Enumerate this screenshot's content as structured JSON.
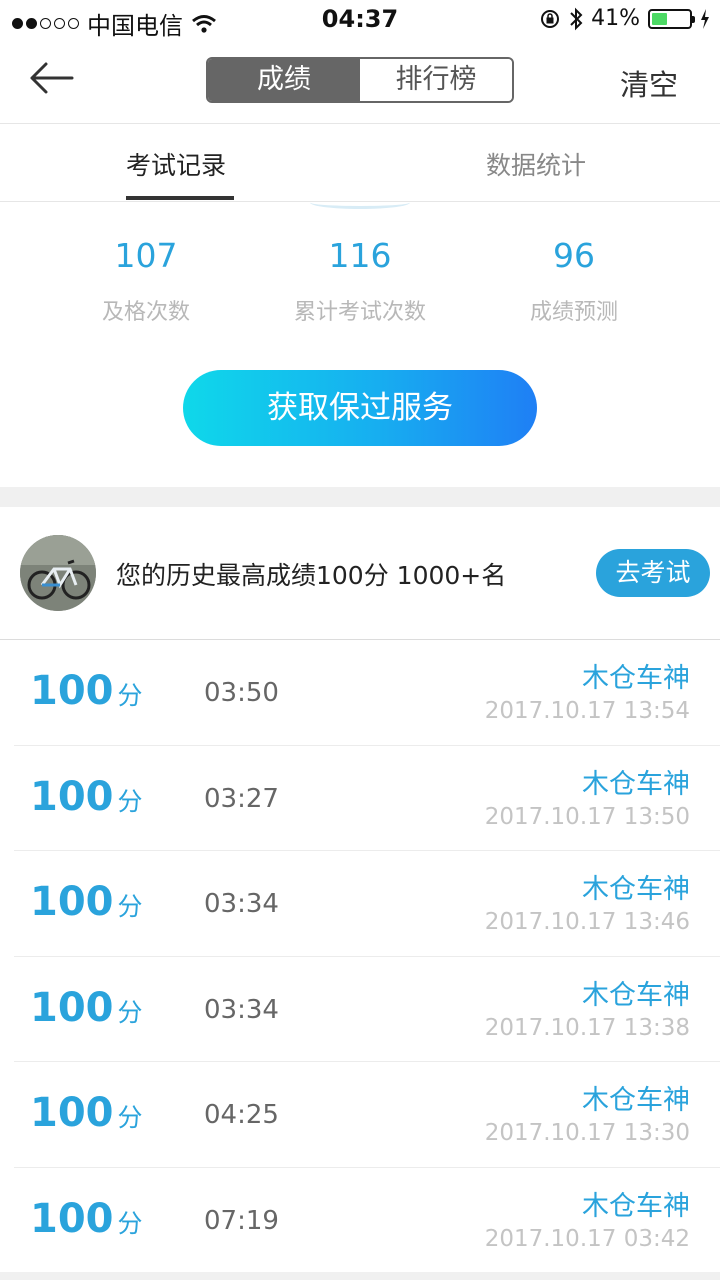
{
  "status_bar": {
    "carrier": "中国电信",
    "time": "04:37",
    "battery": "41%",
    "battery_level": 0.41
  },
  "nav": {
    "segments": [
      "成绩",
      "排行榜"
    ],
    "active_segment": 0,
    "clear_label": "清空"
  },
  "tabs": [
    {
      "label": "考试记录"
    },
    {
      "label": "数据统计"
    }
  ],
  "stats": [
    {
      "value": "107",
      "label": "及格次数"
    },
    {
      "value": "116",
      "label": "累计考试次数"
    },
    {
      "value": "96",
      "label": "成绩预测"
    }
  ],
  "cta_label": "获取保过服务",
  "best": {
    "text": "您的历史最高成绩100分  1000+名",
    "button": "去考试"
  },
  "records": [
    {
      "score": "100",
      "unit": "分",
      "duration": "03:50",
      "name": "木仓车神",
      "date": "2017.10.17 13:54"
    },
    {
      "score": "100",
      "unit": "分",
      "duration": "03:27",
      "name": "木仓车神",
      "date": "2017.10.17 13:50"
    },
    {
      "score": "100",
      "unit": "分",
      "duration": "03:34",
      "name": "木仓车神",
      "date": "2017.10.17 13:46"
    },
    {
      "score": "100",
      "unit": "分",
      "duration": "03:34",
      "name": "木仓车神",
      "date": "2017.10.17 13:38"
    },
    {
      "score": "100",
      "unit": "分",
      "duration": "04:25",
      "name": "木仓车神",
      "date": "2017.10.17 13:30"
    },
    {
      "score": "100",
      "unit": "分",
      "duration": "07:19",
      "name": "木仓车神",
      "date": "2017.10.17 03:42"
    }
  ],
  "colors": {
    "accent": "#2aa3dc",
    "segment_active": "#666666",
    "battery": "#4cd964"
  }
}
